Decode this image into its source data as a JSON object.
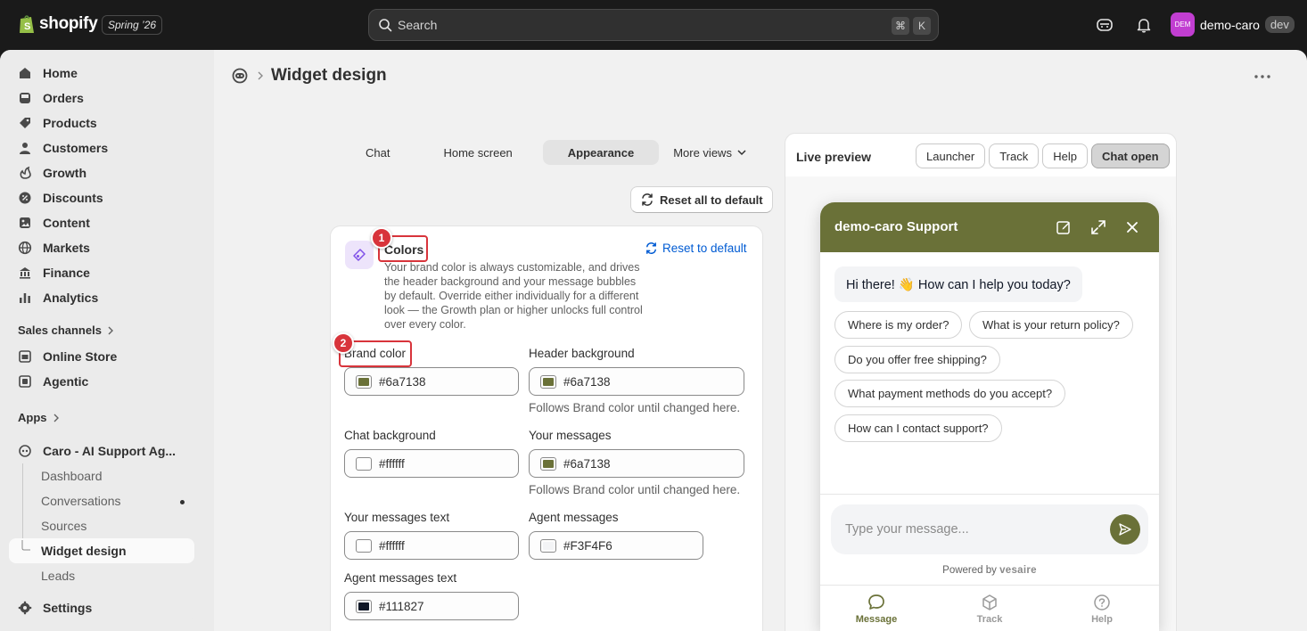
{
  "topbar": {
    "logo_text": "shopify",
    "version": "Spring ’26",
    "search_placeholder": "Search",
    "kbd_cmd": "⌘",
    "kbd_k": "K",
    "avatar_initials": "DEM",
    "store_name": "demo-caro",
    "store_badge": "dev"
  },
  "sidebar": {
    "items": [
      {
        "label": "Home"
      },
      {
        "label": "Orders"
      },
      {
        "label": "Products"
      },
      {
        "label": "Customers"
      },
      {
        "label": "Growth"
      },
      {
        "label": "Discounts"
      },
      {
        "label": "Content"
      },
      {
        "label": "Markets"
      },
      {
        "label": "Finance"
      },
      {
        "label": "Analytics"
      }
    ],
    "sales_channels_label": "Sales channels",
    "channels": [
      {
        "label": "Online Store"
      },
      {
        "label": "Agentic"
      }
    ],
    "apps_label": "Apps",
    "app_name": "Caro - AI Support Ag...",
    "app_sub": [
      "Dashboard",
      "Conversations",
      "Sources",
      "Widget design",
      "Leads"
    ],
    "settings_label": "Settings"
  },
  "page": {
    "title": "Widget design",
    "tabs": [
      "Chat",
      "Home screen",
      "Appearance",
      "More views"
    ],
    "active_tab": "Appearance",
    "reset_all_label": "Reset all to default"
  },
  "colors_card": {
    "title": "Colors",
    "description": "Your brand color is always customizable, and drives the header background and your message bubbles by default. Override either individually for a different look — the Growth plan or higher unlocks full control over every color.",
    "reset_label": "Reset to default",
    "fields": {
      "brand_color": {
        "label": "Brand color",
        "value": "#6a7138",
        "swatch": "#6a7138"
      },
      "header_background": {
        "label": "Header background",
        "value": "#6a7138",
        "swatch": "#6a7138",
        "help": "Follows Brand color until changed here."
      },
      "chat_background": {
        "label": "Chat background",
        "value": "#ffffff",
        "swatch": "#ffffff"
      },
      "your_messages": {
        "label": "Your messages",
        "value": "#6a7138",
        "swatch": "#6a7138",
        "help": "Follows Brand color until changed here."
      },
      "your_messages_text": {
        "label": "Your messages text",
        "value": "#ffffff",
        "swatch": "#ffffff"
      },
      "agent_messages": {
        "label": "Agent messages",
        "value": "#F3F4F6",
        "swatch": "#F3F4F6"
      },
      "agent_messages_text": {
        "label": "Agent messages text",
        "value": "#111827",
        "swatch": "#111827"
      }
    }
  },
  "annotations": [
    "1",
    "2"
  ],
  "preview": {
    "title": "Live preview",
    "buttons": [
      "Launcher",
      "Track",
      "Help",
      "Chat open"
    ],
    "active_button": "Chat open",
    "widget": {
      "header_title": "demo-caro Support",
      "greeting": "Hi there! 👋 How can I help you today?",
      "suggestions": [
        "Where is my order?",
        "What is your return policy?",
        "Do you offer free shipping?",
        "What payment methods do you accept?",
        "How can I contact support?"
      ],
      "input_placeholder": "Type your message...",
      "powered_prefix": "Powered by",
      "powered_brand": "vesaire",
      "nav": [
        "Message",
        "Track",
        "Help"
      ],
      "brand_color": "#6a7138"
    }
  }
}
